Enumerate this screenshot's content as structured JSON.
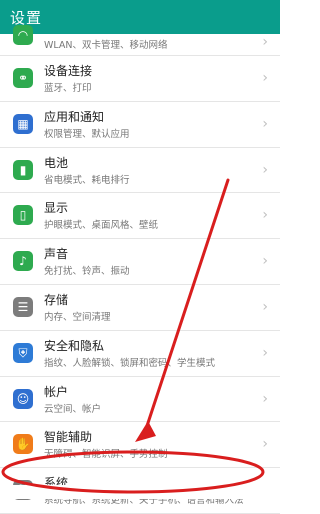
{
  "header": {
    "title": "设置"
  },
  "settings": [
    {
      "title": "",
      "subtitle": "WLAN、双卡管理、移动网络"
    },
    {
      "title": "设备连接",
      "subtitle": "蓝牙、打印"
    },
    {
      "title": "应用和通知",
      "subtitle": "权限管理、默认应用"
    },
    {
      "title": "电池",
      "subtitle": "省电模式、耗电排行"
    },
    {
      "title": "显示",
      "subtitle": "护眼模式、桌面风格、壁纸"
    },
    {
      "title": "声音",
      "subtitle": "免打扰、铃声、振动"
    },
    {
      "title": "存储",
      "subtitle": "内存、空间清理"
    },
    {
      "title": "安全和隐私",
      "subtitle": "指纹、人脸解锁、锁屏和密码、学生模式"
    },
    {
      "title": "帐户",
      "subtitle": "云空间、帐户"
    },
    {
      "title": "智能辅助",
      "subtitle": "无障碍、智能识屏、手势控制"
    },
    {
      "title": "系统",
      "subtitle": "系统导航、系统更新、关于手机、语言和输入法"
    }
  ],
  "icons": {
    "network": "wifi-icon",
    "device": "link-icon",
    "apps": "apps-grid-icon",
    "battery": "battery-icon",
    "display": "phone-display-icon",
    "sound": "speaker-icon",
    "storage": "storage-icon",
    "security": "shield-icon",
    "account": "person-icon",
    "assist": "hand-icon",
    "system": "phone-info-icon"
  },
  "colors": {
    "header": "#0a9d8c",
    "annotation": "#d91e1e"
  }
}
